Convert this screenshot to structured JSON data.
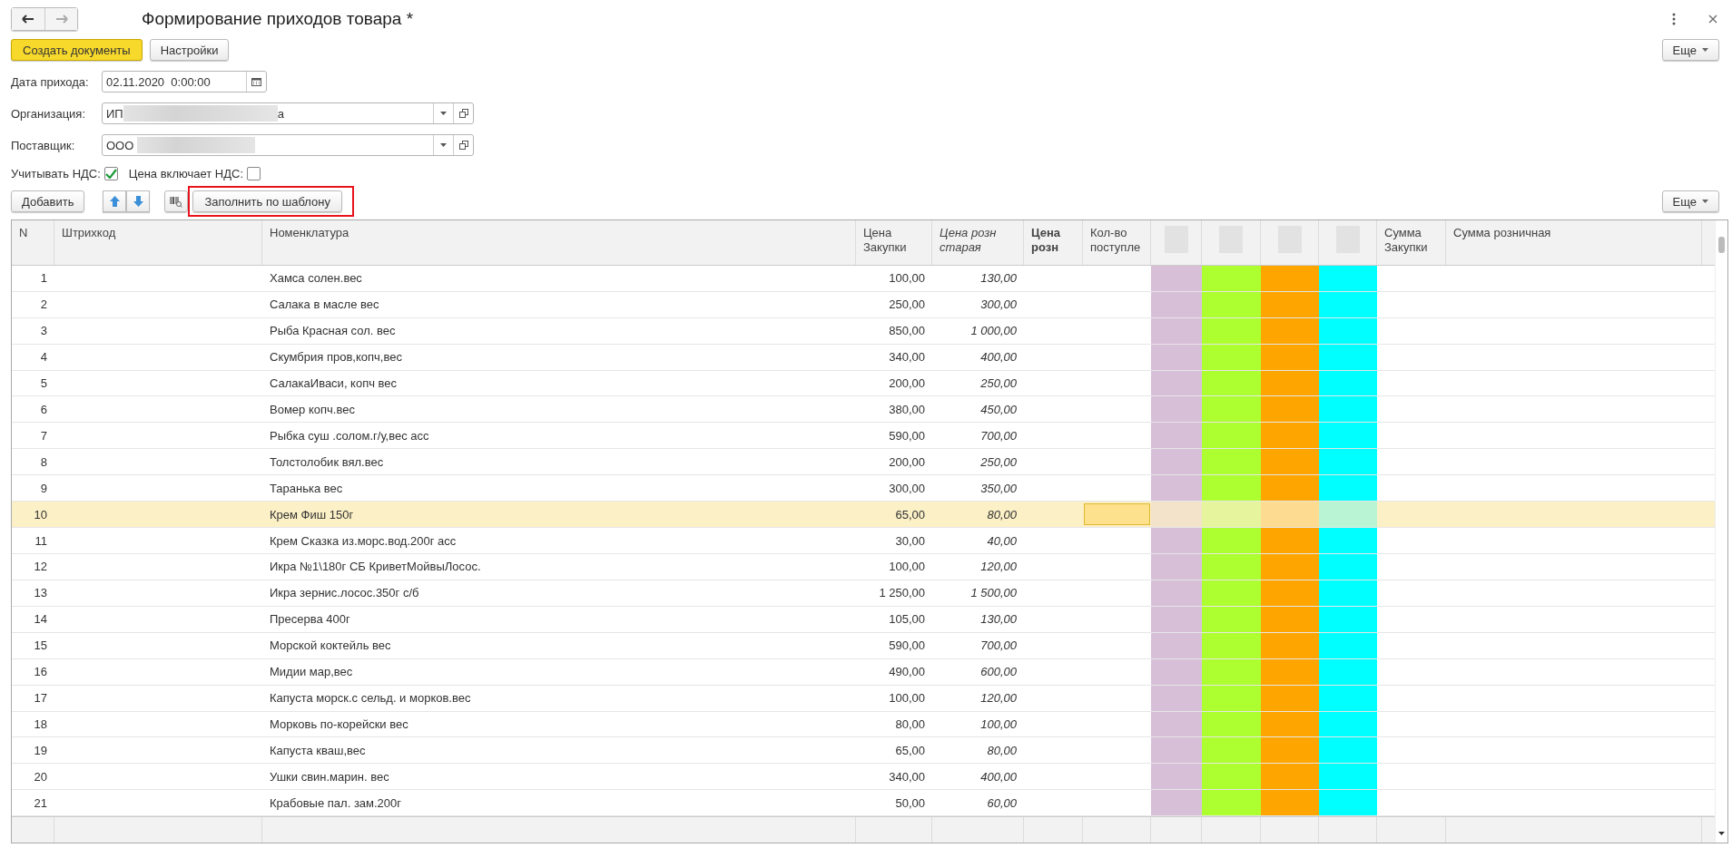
{
  "window": {
    "title": "Формирование приходов товара *"
  },
  "command_bar": {
    "primary": "Создать документы",
    "settings": "Настройки",
    "more": "Еще"
  },
  "form": {
    "date_label": "Дата прихода:",
    "date_value": "02.11.2020  0:00:00",
    "org_label": "Организация:",
    "org_value_start": "ИП",
    "org_value_end": "а",
    "supplier_label": "Поставщик:",
    "supplier_value": "ООО",
    "vat_label": "Учитывать НДС:",
    "vat_checked": true,
    "price_vat_label": "Цена включает НДС:",
    "price_vat_checked": false
  },
  "table_toolbar": {
    "add": "Добавить",
    "fill": "Заполнить по шаблону",
    "fill_highlighted": true,
    "more": "Еще"
  },
  "table": {
    "columns": [
      {
        "label": "N",
        "kind": "plain"
      },
      {
        "label": "Штрихкод",
        "kind": "plain"
      },
      {
        "label": "Номенклатура",
        "kind": "plain"
      },
      {
        "label": "Цена Закупки",
        "kind": "plain"
      },
      {
        "label": "Цена розн старая",
        "kind": "italic"
      },
      {
        "label": "Цена розн",
        "kind": "bold"
      },
      {
        "label": "Кол-во поступле",
        "kind": "plain"
      },
      {
        "kind": "blurred",
        "color": "#d8bfd8"
      },
      {
        "kind": "blurred",
        "color": "#adff2f"
      },
      {
        "kind": "blurred",
        "color": "#ffa500"
      },
      {
        "kind": "blurred",
        "color": "#00ffff"
      },
      {
        "label": "Сумма Закупки",
        "kind": "plain"
      },
      {
        "label": "Сумма розничная",
        "kind": "plain"
      }
    ],
    "rows": [
      {
        "n": "1",
        "name": "Хамса солен.вес",
        "price": "100,00",
        "old_price": "130,00",
        "selected": false
      },
      {
        "n": "2",
        "name": "Салака в масле вес",
        "price": "250,00",
        "old_price": "300,00",
        "selected": false
      },
      {
        "n": "3",
        "name": "Рыба Красная сол. вес",
        "price": "850,00",
        "old_price": "1 000,00",
        "selected": false
      },
      {
        "n": "4",
        "name": "Скумбрия пров,копч,вес",
        "price": "340,00",
        "old_price": "400,00",
        "selected": false
      },
      {
        "n": "5",
        "name": "СалакаИваси, копч вес",
        "price": "200,00",
        "old_price": "250,00",
        "selected": false
      },
      {
        "n": "6",
        "name": "Вомер копч.вес",
        "price": "380,00",
        "old_price": "450,00",
        "selected": false
      },
      {
        "n": "7",
        "name": "Рыбка суш .солом.г/у,вес асс",
        "price": "590,00",
        "old_price": "700,00",
        "selected": false
      },
      {
        "n": "8",
        "name": "Толстолобик вял.вес",
        "price": "200,00",
        "old_price": "250,00",
        "selected": false
      },
      {
        "n": "9",
        "name": "Таранька вес",
        "price": "300,00",
        "old_price": "350,00",
        "selected": false
      },
      {
        "n": "10",
        "name": "Крем Фиш 150г",
        "price": "65,00",
        "old_price": "80,00",
        "selected": true
      },
      {
        "n": "11",
        "name": "Крем Сказка из.морс.вод.200г асс",
        "price": "30,00",
        "old_price": "40,00",
        "selected": false
      },
      {
        "n": "12",
        "name": "Икра №1\\180г СБ КриветМойвыЛосос.",
        "price": "100,00",
        "old_price": "120,00",
        "selected": false
      },
      {
        "n": "13",
        "name": "Икра зернис.лосос.350г с/б",
        "price": "1 250,00",
        "old_price": "1 500,00",
        "selected": false
      },
      {
        "n": "14",
        "name": "Пресерва 400г",
        "price": "105,00",
        "old_price": "130,00",
        "selected": false
      },
      {
        "n": "15",
        "name": "Морской коктейль вес",
        "price": "590,00",
        "old_price": "700,00",
        "selected": false
      },
      {
        "n": "16",
        "name": "Мидии мар,вес",
        "price": "490,00",
        "old_price": "600,00",
        "selected": false
      },
      {
        "n": "17",
        "name": "Капуста морск.с сельд.  и  морков.вес",
        "price": "100,00",
        "old_price": "120,00",
        "selected": false
      },
      {
        "n": "18",
        "name": "Морковь по-корейски вес",
        "price": "80,00",
        "old_price": "100,00",
        "selected": false
      },
      {
        "n": "19",
        "name": "Капуста кваш,вес",
        "price": "65,00",
        "old_price": "80,00",
        "selected": false
      },
      {
        "n": "20",
        "name": "Ушки свин.марин. вес",
        "price": "340,00",
        "old_price": "400,00",
        "selected": false
      },
      {
        "n": "21",
        "name": "Крабовые пал. зам.200г",
        "price": "50,00",
        "old_price": "60,00",
        "selected": false
      }
    ]
  }
}
